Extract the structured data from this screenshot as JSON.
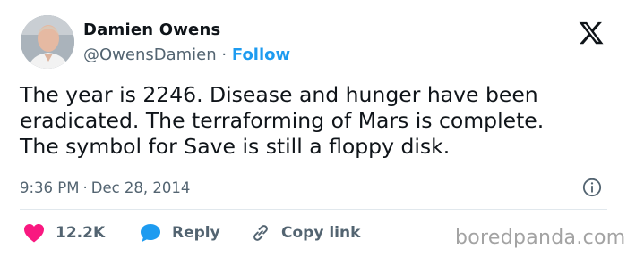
{
  "author": {
    "name": "Damien Owens",
    "handle": "@OwensDamien",
    "separator": "·",
    "follow_label": "Follow"
  },
  "tweet": {
    "lines": [
      "The year is 2246. Disease and hunger have been",
      "eradicated. The terraforming of Mars is complete.",
      "The symbol for Save is still a floppy disk."
    ]
  },
  "meta": {
    "time": "9:36 PM",
    "separator": "·",
    "date": "Dec 28, 2014"
  },
  "actions": {
    "likes": "12.2K",
    "reply_label": "Reply",
    "copy_label": "Copy link"
  },
  "watermark": "boredpanda.com",
  "icons": {
    "platform": "x-logo-icon",
    "info": "info-icon",
    "like": "heart-icon",
    "reply": "speech-bubble-icon",
    "copy": "link-icon"
  },
  "colors": {
    "text": "#0f1419",
    "secondary": "#536471",
    "accent": "#1d9bf0",
    "heart": "#f91880",
    "watermark": "#a3a3a3"
  }
}
